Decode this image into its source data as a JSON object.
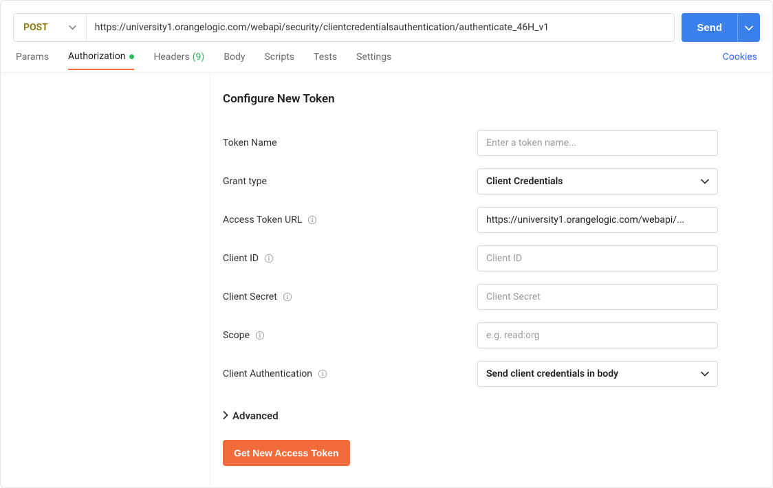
{
  "method": "POST",
  "url": "https://university1.orangelogic.com/webapi/security/clientcredentialsauthentication/authenticate_46H_v1",
  "send_label": "Send",
  "tabs": {
    "params": "Params",
    "authorization": "Authorization",
    "headers": "Headers",
    "headers_count": "(9)",
    "body": "Body",
    "scripts": "Scripts",
    "tests": "Tests",
    "settings": "Settings"
  },
  "cookies_label": "Cookies",
  "auth": {
    "title": "Configure New Token",
    "fields": {
      "token_name": {
        "label": "Token Name",
        "placeholder": "Enter a token name..."
      },
      "grant_type": {
        "label": "Grant type",
        "value": "Client Credentials"
      },
      "access_token_url": {
        "label": "Access Token URL",
        "value": "https://university1.orangelogic.com/webapi/..."
      },
      "client_id": {
        "label": "Client ID",
        "placeholder": "Client ID"
      },
      "client_secret": {
        "label": "Client Secret",
        "placeholder": "Client Secret"
      },
      "scope": {
        "label": "Scope",
        "placeholder": "e.g. read:org"
      },
      "client_auth": {
        "label": "Client Authentication",
        "value": "Send client credentials in body"
      }
    },
    "advanced_label": "Advanced",
    "get_token_label": "Get New Access Token"
  }
}
